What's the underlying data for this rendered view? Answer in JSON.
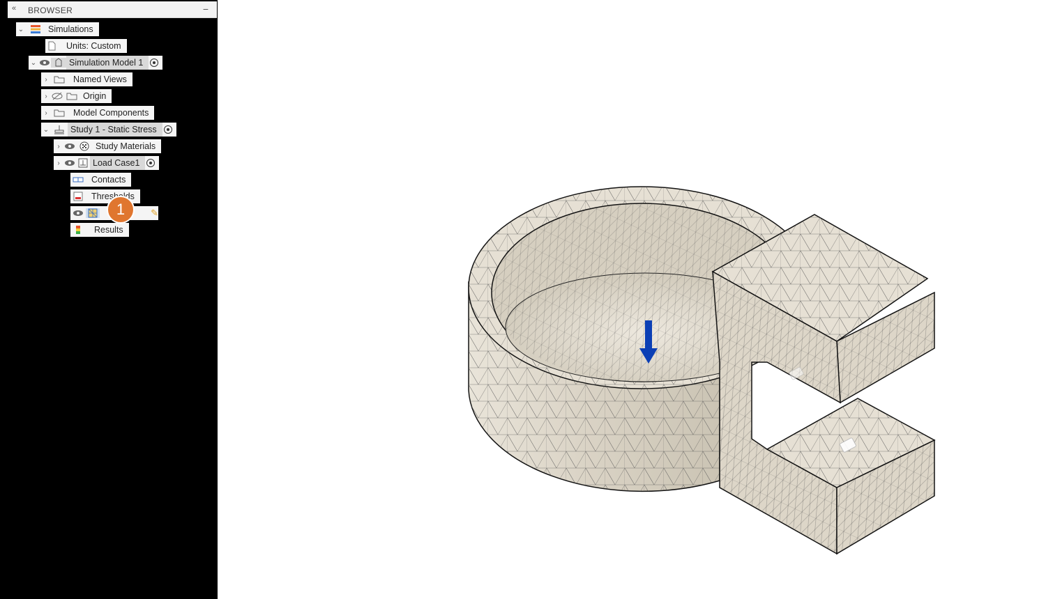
{
  "browser": {
    "title": "BROWSER",
    "collapse_glyph": "«",
    "minimize_glyph": "−"
  },
  "tree": {
    "simulations": "Simulations",
    "units": "Units: Custom",
    "simulation_model": "Simulation Model 1",
    "named_views": "Named Views",
    "origin": "Origin",
    "model_components": "Model Components",
    "study": "Study 1 - Static Stress",
    "study_materials": "Study Materials",
    "load_case": "Load Case1",
    "contacts": "Contacts",
    "thresholds": "Thresholds",
    "results": "Results"
  },
  "callout": {
    "number": "1",
    "color": "#e0762f"
  },
  "colors": {
    "panel_bg": "#000000",
    "node_bg": "#f5f5f5",
    "mesh_fill": "#e6e0d4",
    "load_arrow": "#0b3fb5"
  },
  "icons": {
    "expand": "chevron-down-icon",
    "collapsed": "chevron-right-icon",
    "visibility": "eye-icon",
    "hidden": "eye-slash-icon",
    "folder": "folder-icon",
    "load": "load-arrow-icon"
  }
}
